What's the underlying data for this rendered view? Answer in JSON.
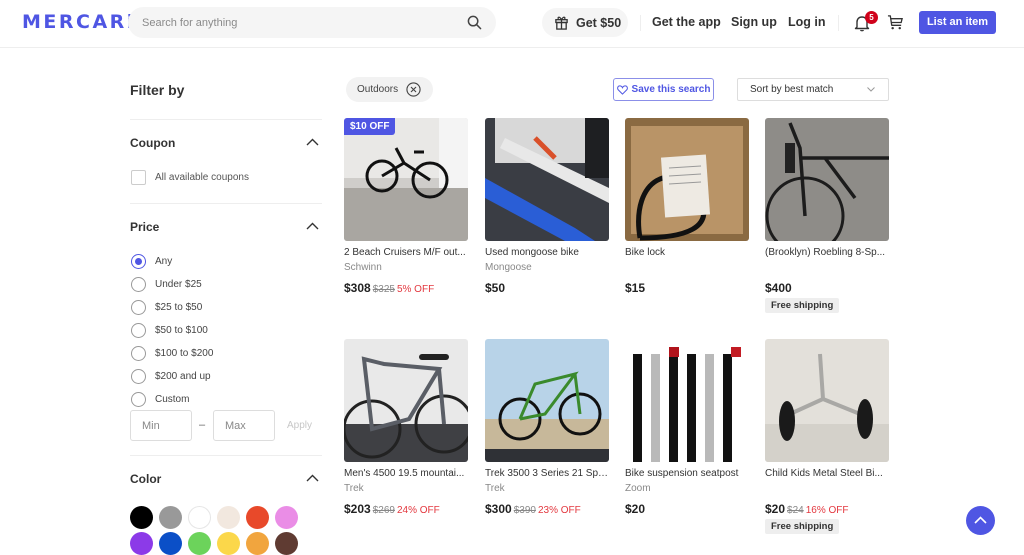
{
  "header": {
    "logo": "MERCARi",
    "search_placeholder": "Search for anything",
    "get50_label": "Get $50",
    "get_app": "Get the app",
    "sign_up": "Sign up",
    "log_in": "Log in",
    "notification_count": "5",
    "list_item": "List an item"
  },
  "sidebar": {
    "title": "Filter by",
    "coupon": {
      "title": "Coupon",
      "option": "All available coupons"
    },
    "price": {
      "title": "Price",
      "options": [
        "Any",
        "Under $25",
        "$25 to $50",
        "$50 to $100",
        "$100 to $200",
        "$200 and up",
        "Custom"
      ],
      "selected": "Any",
      "min_placeholder": "Min",
      "max_placeholder": "Max",
      "dash": "–",
      "apply": "Apply"
    },
    "color": {
      "title": "Color",
      "swatches": [
        "#000000",
        "#999999",
        "#ffffff",
        "#f2e8df",
        "#e8492a",
        "#ea8de6",
        "#8c3ae8",
        "#0b4fc7",
        "#6cd35b",
        "#fbd74a",
        "#f1a53e",
        "#5f3b32"
      ]
    }
  },
  "toolbar": {
    "chip": "Outdoors",
    "save_search": "Save this search",
    "sort": "Sort by best match"
  },
  "products": [
    {
      "title": "2 Beach Cruisers M/F out...",
      "brand": "Schwinn",
      "price": "$308",
      "original": "$325",
      "discount": "5% OFF",
      "promo": "$10 OFF",
      "shipping": ""
    },
    {
      "title": "Used mongoose bike",
      "brand": "Mongoose",
      "price": "$50",
      "original": "",
      "discount": "",
      "promo": "",
      "shipping": ""
    },
    {
      "title": "Bike lock",
      "brand": "",
      "price": "$15",
      "original": "",
      "discount": "",
      "promo": "",
      "shipping": ""
    },
    {
      "title": "(Brooklyn) Roebling 8-Sp...",
      "brand": "",
      "price": "$400",
      "original": "",
      "discount": "",
      "promo": "",
      "shipping": "Free shipping"
    },
    {
      "title": "Men's 4500 19.5 mountai...",
      "brand": "Trek",
      "price": "$203",
      "original": "$269",
      "discount": "24% OFF",
      "promo": "",
      "shipping": ""
    },
    {
      "title": "Trek 3500 3 Series 21 Spe...",
      "brand": "Trek",
      "price": "$300",
      "original": "$390",
      "discount": "23% OFF",
      "promo": "",
      "shipping": ""
    },
    {
      "title": "Bike suspension seatpost",
      "brand": "Zoom",
      "price": "$20",
      "original": "",
      "discount": "",
      "promo": "",
      "shipping": ""
    },
    {
      "title": "Child Kids Metal Steel Bi...",
      "brand": "",
      "price": "$20",
      "original": "$24",
      "discount": "16% OFF",
      "promo": "",
      "shipping": "Free shipping"
    }
  ],
  "colors": {
    "brand": "#4f56e3",
    "discount": "#e3383f",
    "badge": "#d0021b"
  }
}
